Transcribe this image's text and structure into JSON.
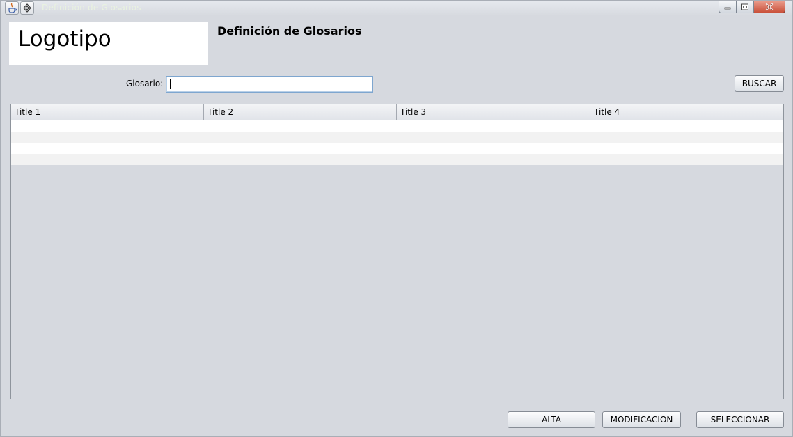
{
  "window": {
    "title": "Definición de Glosarios"
  },
  "header": {
    "logo_text": "Logotipo",
    "page_title": "Definición de Glosarios"
  },
  "search": {
    "label": "Glosario:",
    "value": "",
    "button_label": "BUSCAR"
  },
  "table": {
    "columns": [
      "Title 1",
      "Title 2",
      "Title 3",
      "Title 4"
    ],
    "rows": [
      [
        "",
        "",
        "",
        ""
      ],
      [
        "",
        "",
        "",
        ""
      ],
      [
        "",
        "",
        "",
        ""
      ],
      [
        "",
        "",
        "",
        ""
      ]
    ]
  },
  "footer": {
    "alta_label": "ALTA",
    "modificacion_label": "MODIFICACION",
    "seleccionar_label": "SELECCIONAR"
  },
  "icons": {
    "app": "java-icon",
    "menu": "window-menu-icon",
    "minimize": "minimize-icon",
    "maximize": "maximize-icon",
    "close": "close-icon"
  },
  "colors": {
    "background": "#d6d9df",
    "close_button": "#c9503a",
    "title_text": "#e9f2e0"
  }
}
